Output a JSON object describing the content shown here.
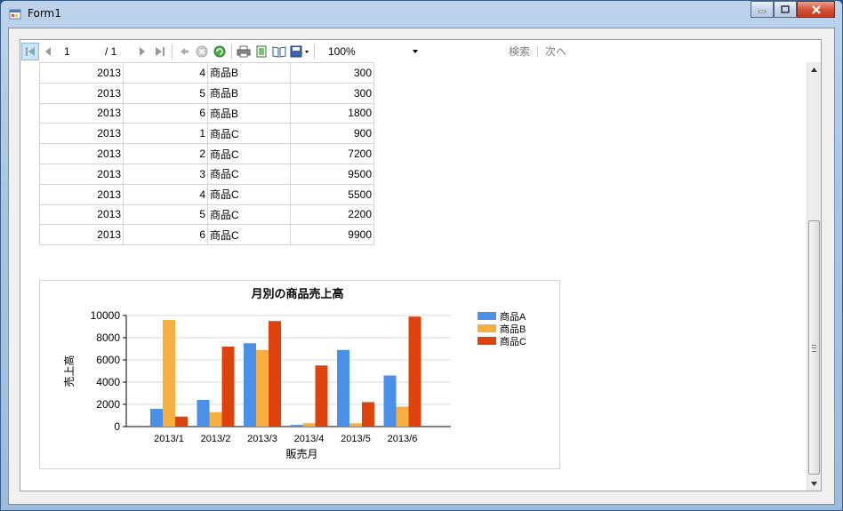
{
  "window": {
    "title": "Form1"
  },
  "toolbar": {
    "current_page": "1",
    "total_pages": "/ 1",
    "zoom": "100%",
    "find_label": "検索",
    "next_label": "次へ"
  },
  "table": {
    "rows": [
      [
        "2013",
        "4",
        "商品B",
        "300"
      ],
      [
        "2013",
        "5",
        "商品B",
        "300"
      ],
      [
        "2013",
        "6",
        "商品B",
        "1800"
      ],
      [
        "2013",
        "1",
        "商品C",
        "900"
      ],
      [
        "2013",
        "2",
        "商品C",
        "7200"
      ],
      [
        "2013",
        "3",
        "商品C",
        "9500"
      ],
      [
        "2013",
        "4",
        "商品C",
        "5500"
      ],
      [
        "2013",
        "5",
        "商品C",
        "2200"
      ],
      [
        "2013",
        "6",
        "商品C",
        "9900"
      ]
    ]
  },
  "chart_data": {
    "type": "bar",
    "title": "月別の商品売上高",
    "xlabel": "販売月",
    "ylabel": "売上高",
    "categories": [
      "2013/1",
      "2013/2",
      "2013/3",
      "2013/4",
      "2013/5",
      "2013/6"
    ],
    "series": [
      {
        "name": "商品A",
        "color": "#4a8fe8",
        "values": [
          1600,
          2400,
          7500,
          150,
          6900,
          4600
        ]
      },
      {
        "name": "商品B",
        "color": "#f7b040",
        "values": [
          9600,
          1300,
          6900,
          300,
          300,
          1800
        ]
      },
      {
        "name": "商品C",
        "color": "#df430d",
        "values": [
          900,
          7200,
          9500,
          5500,
          2200,
          9900
        ]
      }
    ],
    "ylim": [
      0,
      10000
    ],
    "yticks": [
      "0",
      "2000",
      "4000",
      "6000",
      "8000",
      "10000"
    ],
    "grid": true,
    "legend": "right"
  }
}
